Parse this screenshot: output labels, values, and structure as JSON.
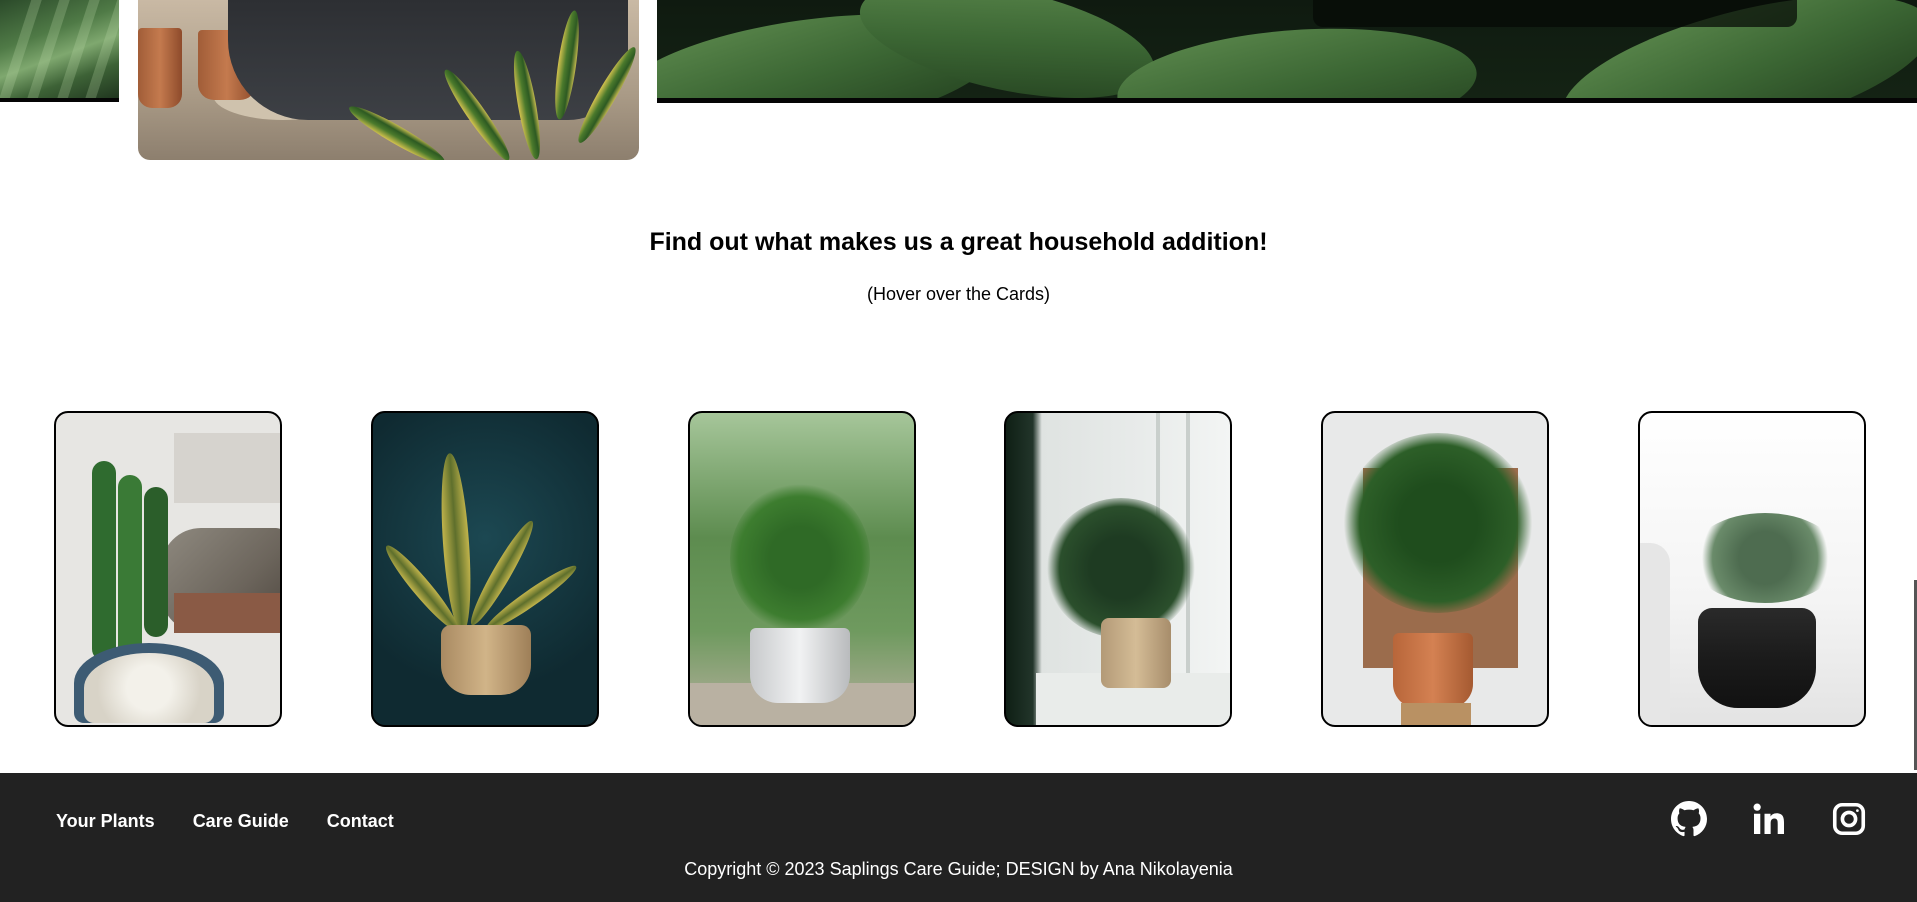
{
  "intro": {
    "title": "Find out what makes us a great household addition!",
    "hint": "(Hover over the Cards)"
  },
  "cards": [
    {
      "name": "cactus-cat-card",
      "bg": "#e7e6e3"
    },
    {
      "name": "snake-plant-card",
      "bg": "#102c32"
    },
    {
      "name": "zz-plant-card",
      "bg": "#7da66a"
    },
    {
      "name": "monstera-window-card",
      "bg": "#e6e9e7"
    },
    {
      "name": "fiddle-leaf-card",
      "bg": "#e9eaea"
    },
    {
      "name": "succulent-black-pot-card",
      "bg": "#f1f1f1"
    }
  ],
  "footer": {
    "links": [
      "Your Plants",
      "Care Guide",
      "Contact"
    ],
    "social_icons": [
      "github-icon",
      "linkedin-icon",
      "instagram-icon"
    ],
    "copyright": "Copyright © 2023 Saplings Care Guide; DESIGN by Ana Nikolayenia",
    "background": "#222222"
  }
}
